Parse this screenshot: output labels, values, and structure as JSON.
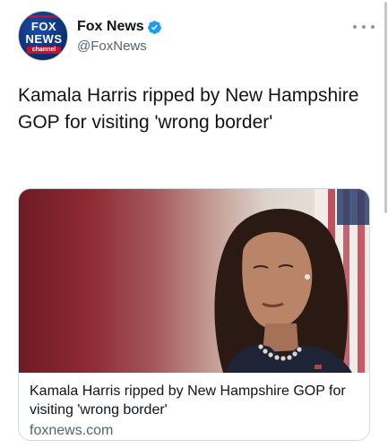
{
  "account": {
    "display_name": "Fox News",
    "handle": "@FoxNews",
    "verified": true,
    "avatar_logo": {
      "line1": "FOX",
      "line2": "NEWS",
      "line3": "channel"
    }
  },
  "tweet": {
    "text": "Kamala Harris ripped by New Hampshire GOP for visiting 'wrong border'"
  },
  "card": {
    "title": "Kamala Harris ripped by New Hampshire GOP for visiting 'wrong border'",
    "domain": "foxnews.com"
  },
  "icons": {
    "verified": "verified-badge-icon",
    "more": "more-options-icon"
  },
  "colors": {
    "verified_blue": "#1d9bf0",
    "text_primary": "#0f1419",
    "text_secondary": "#536471",
    "border": "#cfd9de"
  }
}
